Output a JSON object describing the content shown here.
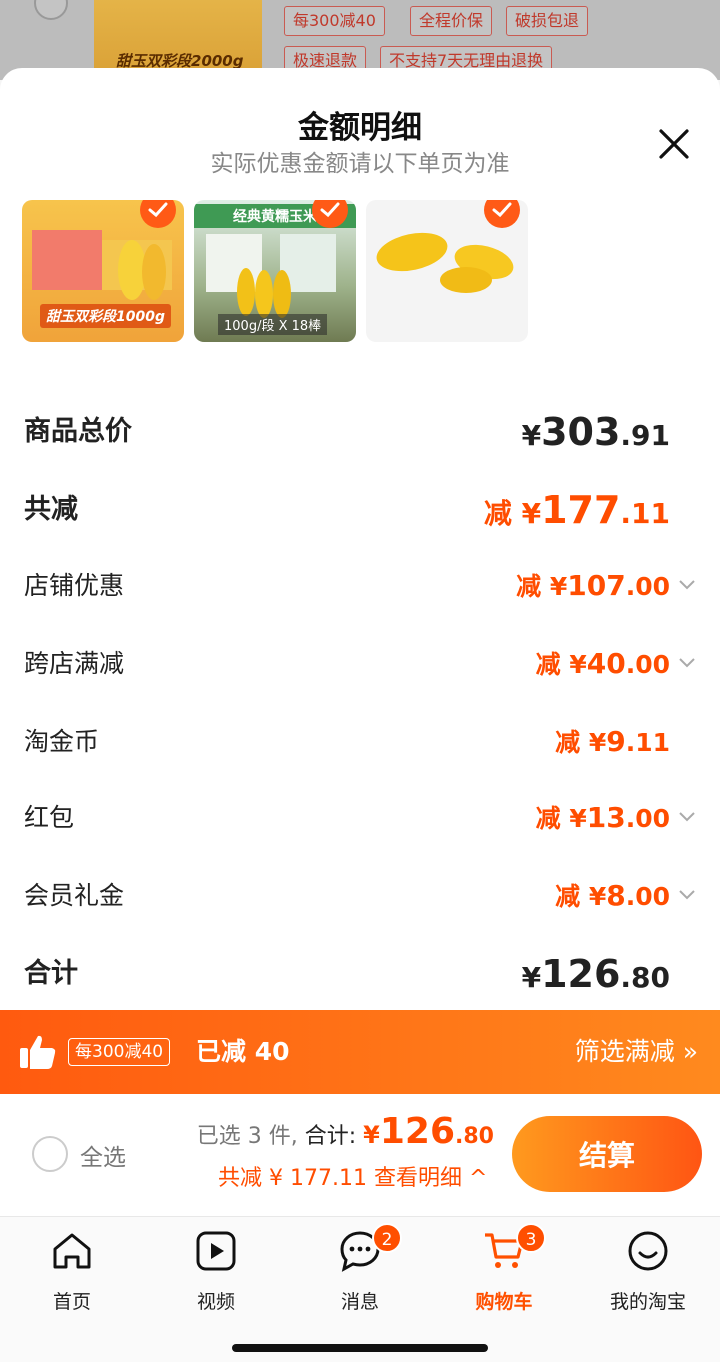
{
  "background": {
    "thumb_text": "甜玉双彩段2000g",
    "tags": [
      "每300减40",
      "全程价保",
      "破损包退",
      "极速退款",
      "不支持7天无理由退换"
    ]
  },
  "sheet": {
    "title": "金额明细",
    "subtitle": "实际优惠金额请以下单页为准",
    "close_icon": "close-icon",
    "thumbnails": [
      {
        "label": "甜玉双彩段1000g",
        "checked": true
      },
      {
        "top": "经典黄糯玉米",
        "label": "100g/段 X 18棒",
        "checked": true
      },
      {
        "checked": true
      }
    ],
    "rows": [
      {
        "label": "商品总价",
        "prefix": "¥",
        "int": "303",
        "dec": ".91",
        "style": "total"
      },
      {
        "label": "共减",
        "prefix": "减 ¥",
        "int": "177",
        "dec": ".11",
        "style": "discount-total"
      },
      {
        "label": "店铺优惠",
        "prefix": "减 ¥",
        "int": "107",
        "dec": ".00",
        "chevron": true
      },
      {
        "label": "跨店满减",
        "prefix": "减 ¥",
        "int": "40",
        "dec": ".00",
        "chevron": true
      },
      {
        "label": "淘金币",
        "prefix": "减 ¥",
        "int": "9",
        "dec": ".11",
        "chevron": false
      },
      {
        "label": "红包",
        "prefix": "减 ¥",
        "int": "13",
        "dec": ".00",
        "chevron": true
      },
      {
        "label": "会员礼金",
        "prefix": "减 ¥",
        "int": "8",
        "dec": ".00",
        "chevron": true
      },
      {
        "label": "合计",
        "prefix": "¥",
        "int": "126",
        "dec": ".80",
        "style": "total"
      }
    ]
  },
  "promo": {
    "icon": "thumbs-up-icon",
    "tag": "每300减40",
    "text": "已减 40",
    "link": "筛选满减 »"
  },
  "checkout": {
    "select_all": "全选",
    "selected_text": "已选 3 件,",
    "total_label": "合计:",
    "currency": "¥",
    "total_int": "126",
    "total_dec": ".80",
    "discount_text": "共减 ¥ 177.11",
    "detail_link": "查看明细 ^",
    "button": "结算"
  },
  "tabs": [
    {
      "label": "首页",
      "icon": "home-icon"
    },
    {
      "label": "视频",
      "icon": "video-icon"
    },
    {
      "label": "消息",
      "icon": "message-icon",
      "badge": "2"
    },
    {
      "label": "购物车",
      "icon": "cart-icon",
      "badge": "3",
      "active": true
    },
    {
      "label": "我的淘宝",
      "icon": "profile-icon"
    }
  ],
  "colors": {
    "accent": "#ff5000",
    "discount": "#ff4d00"
  }
}
